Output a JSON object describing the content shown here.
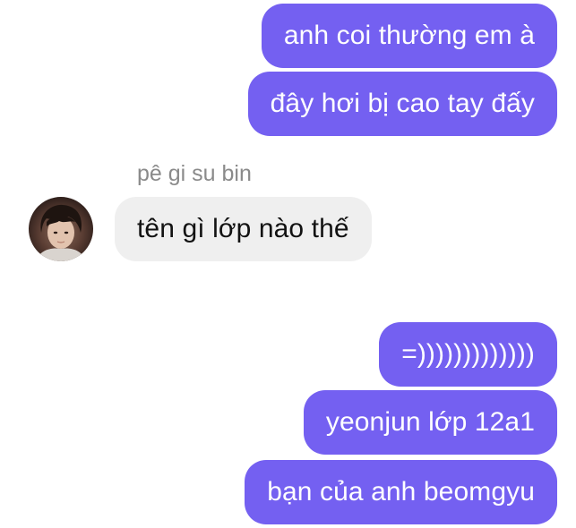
{
  "conversation": {
    "messages": [
      {
        "direction": "outgoing",
        "text": "anh coi thường em à"
      },
      {
        "direction": "outgoing",
        "text": "đây hơi bị cao tay đấy"
      },
      {
        "direction": "incoming",
        "sender": "pê gi su bin",
        "text": "tên gì lớp nào thế"
      },
      {
        "direction": "outgoing",
        "text": "=)))))))))))))"
      },
      {
        "direction": "outgoing",
        "text": "yeonjun lớp 12a1"
      },
      {
        "direction": "outgoing",
        "text": "bạn của anh beomgyu"
      }
    ]
  },
  "colors": {
    "outgoing_bubble": "#7460f1",
    "incoming_bubble": "#efefef",
    "sender_name": "#8a8a8a"
  },
  "icons": {
    "avatar": "user-avatar-photo"
  }
}
